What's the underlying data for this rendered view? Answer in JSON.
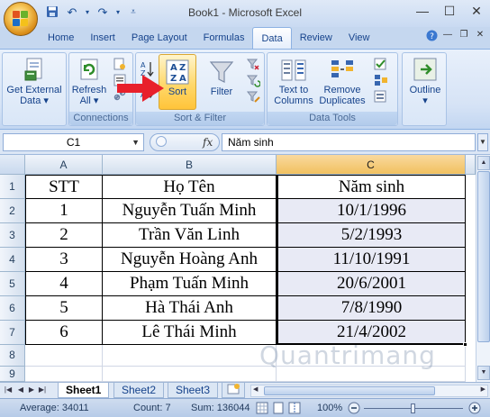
{
  "window": {
    "title": "Book1 - Microsoft Excel",
    "controls": [
      "—",
      "☐",
      "✕"
    ]
  },
  "qat_icons": [
    "save-icon",
    "undo-icon",
    "redo-icon",
    "customize-icon"
  ],
  "tabs": [
    {
      "label": "Home"
    },
    {
      "label": "Insert"
    },
    {
      "label": "Page Layout"
    },
    {
      "label": "Formulas"
    },
    {
      "label": "Data",
      "active": true
    },
    {
      "label": "Review"
    },
    {
      "label": "View"
    }
  ],
  "ribbon": {
    "get_external": {
      "line1": "Get External",
      "line2": "Data ▾"
    },
    "refresh": {
      "line1": "Refresh",
      "line2": "All ▾"
    },
    "connections_label": "Connections",
    "sort_btn": "Sort",
    "filter_btn": "Filter",
    "sort_filter_label": "Sort & Filter",
    "text_to_columns": {
      "line1": "Text to",
      "line2": "Columns"
    },
    "remove_dup": {
      "line1": "Remove",
      "line2": "Duplicates"
    },
    "data_tools_label": "Data Tools",
    "outline": {
      "line1": "Outline",
      "line2": "▾"
    }
  },
  "formula_bar": {
    "name_box": "C1",
    "fx": "fx",
    "content": "Năm sinh"
  },
  "sheet": {
    "columns": [
      "A",
      "B",
      "C"
    ],
    "rows": [
      "1",
      "2",
      "3",
      "4",
      "5",
      "6",
      "7",
      "8",
      "9"
    ],
    "data": [
      [
        "STT",
        "Họ Tên",
        "Năm sinh"
      ],
      [
        "1",
        "Nguyễn Tuấn Minh",
        "10/1/1996"
      ],
      [
        "2",
        "Trần Văn Linh",
        "5/2/1993"
      ],
      [
        "3",
        "Nguyễn Hoàng Anh",
        "11/10/1991"
      ],
      [
        "4",
        "Phạm Tuấn Minh",
        "20/6/2001"
      ],
      [
        "5",
        "Hà Thái Anh",
        "7/8/1990"
      ],
      [
        "6",
        "Lê Thái Minh",
        "21/4/2002"
      ]
    ]
  },
  "sheet_tabs": [
    {
      "label": "Sheet1",
      "active": true
    },
    {
      "label": "Sheet2"
    },
    {
      "label": "Sheet3"
    }
  ],
  "status": {
    "average": "Average: 34011",
    "count": "Count: 7",
    "sum": "Sum: 136044",
    "zoom": "100%"
  },
  "watermark": "Quantrimang",
  "colors": {
    "accent_arrow": "#e8202b",
    "sort_highlight": "#ffd86b",
    "selected_fill": "#e8eaf5"
  }
}
